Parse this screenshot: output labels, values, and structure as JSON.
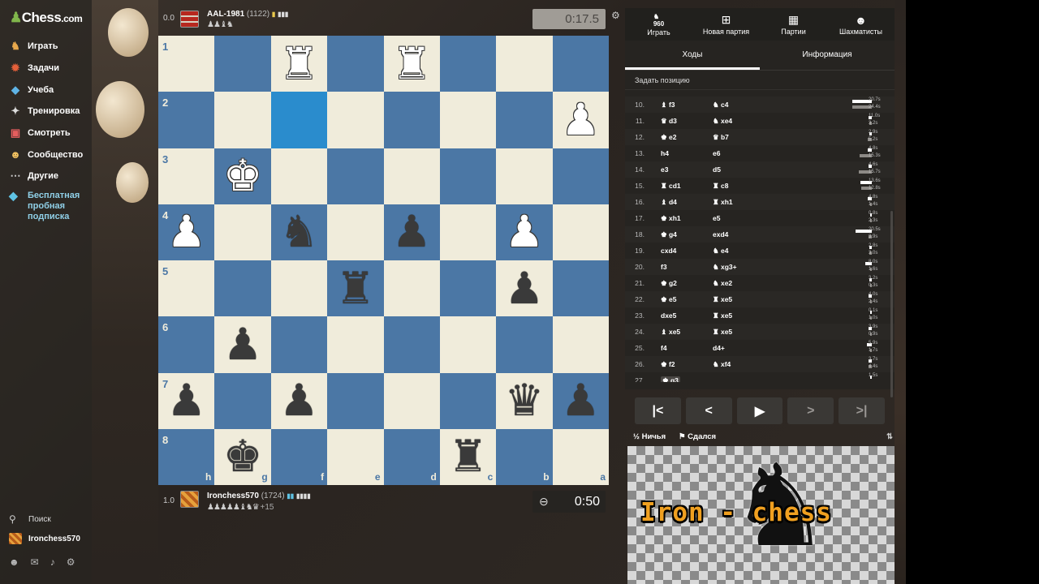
{
  "sidebar": {
    "logo": "Chess",
    "logo_suffix": ".com",
    "items": [
      {
        "label": "Играть",
        "icon": "play-icon"
      },
      {
        "label": "Задачи",
        "icon": "puzzle-icon"
      },
      {
        "label": "Учеба",
        "icon": "learn-icon"
      },
      {
        "label": "Тренировка",
        "icon": "train-icon"
      },
      {
        "label": "Смотреть",
        "icon": "watch-icon"
      },
      {
        "label": "Сообщество",
        "icon": "community-icon"
      },
      {
        "label": "Другие",
        "icon": "more-icon"
      }
    ],
    "promo": "Бесплатная пробная подписка",
    "search": "Поиск",
    "username": "Ironchess570"
  },
  "top_player": {
    "score": "0.0",
    "name": "AAL-1981",
    "rating": "(1122)",
    "clock": "0:17.5"
  },
  "bottom_player": {
    "score": "1.0",
    "name": "Ironchess570",
    "rating": "(1724)",
    "captured_extra": "+15",
    "clock": "0:50"
  },
  "board": {
    "ranks": [
      "1",
      "2",
      "3",
      "4",
      "5",
      "6",
      "7",
      "8"
    ],
    "files": [
      "h",
      "g",
      "f",
      "e",
      "d",
      "c",
      "b",
      "a"
    ]
  },
  "panel": {
    "tabs": [
      {
        "label": "Играть",
        "icon": "960-icon",
        "badge": "960"
      },
      {
        "label": "Новая партия",
        "icon": "plus-icon"
      },
      {
        "label": "Партии",
        "icon": "games-icon"
      },
      {
        "label": "Шахматисты",
        "icon": "players-icon"
      }
    ],
    "subtabs": [
      "Ходы",
      "Информация"
    ],
    "set_position": "Задать позицию",
    "moves": [
      {
        "n": "10.",
        "w": "f3",
        "b": "c4",
        "t1": "20.7s",
        "t2": "24.4s"
      },
      {
        "n": "11.",
        "w": "d3",
        "b": "xe4",
        "t1": "11.0s",
        "t2": "3.2s"
      },
      {
        "n": "12.",
        "w": "e2",
        "b": "b7",
        "t1": "2.9s",
        "t2": "5.2s"
      },
      {
        "n": "13.",
        "w": "h4",
        "b": "e6",
        "t1": "4.8s",
        "t2": "15.3s"
      },
      {
        "n": "14.",
        "w": "e3",
        "b": "d5",
        "t1": "4.6s",
        "t2": "15.7s"
      },
      {
        "n": "15.",
        "w": "cd1",
        "b": "c8",
        "t1": "13.6s",
        "t2": "12.8s"
      },
      {
        "n": "16.",
        "w": "d4",
        "b": "xh1",
        "t1": "4.8s",
        "t2": "1.4s"
      },
      {
        "n": "17.",
        "w": "xh1",
        "b": "e5",
        "t1": "0.8s",
        "t2": "2.3s"
      },
      {
        "n": "18.",
        "w": "g4",
        "b": "exd4",
        "t1": "20.5s",
        "t2": "3.9s"
      },
      {
        "n": "19.",
        "w": "cxd4",
        "b": "e4",
        "t1": "2.8s",
        "t2": "3.0s"
      },
      {
        "n": "20.",
        "w": "f3",
        "b": "xg3+",
        "t1": "8.0s",
        "t2": "1.6s"
      },
      {
        "n": "21.",
        "w": "g2",
        "b": "xe2",
        "t1": "3.2s",
        "t2": "0.3s"
      },
      {
        "n": "22.",
        "w": "e5",
        "b": "xe5",
        "t1": "4.0s",
        "t2": "2.4s"
      },
      {
        "n": "23.",
        "w": "dxe5",
        "b": "xe5",
        "t1": "0.1s",
        "t2": "1.0s"
      },
      {
        "n": "24.",
        "w": "xe5",
        "b": "xe5",
        "t1": "3.9s",
        "t2": "0.9s"
      },
      {
        "n": "25.",
        "w": "f4",
        "b": "d4+",
        "t1": "5.9s",
        "t2": "1.7s"
      },
      {
        "n": "26.",
        "w": "f2",
        "b": "xf4",
        "t1": "3.7s",
        "t2": "4.4s"
      },
      {
        "n": "27.",
        "w": "g3",
        "b": "",
        "t1": "1.5s",
        "t2": ""
      }
    ],
    "draw": "Ничья",
    "resign": "Сдался"
  },
  "banner": {
    "text": "Iron - chess"
  },
  "colors": {
    "light_square": "#f0ecdb",
    "dark_square": "#4b77a5",
    "highlight": "#2a8ccd",
    "accent_green": "#81b64c"
  }
}
